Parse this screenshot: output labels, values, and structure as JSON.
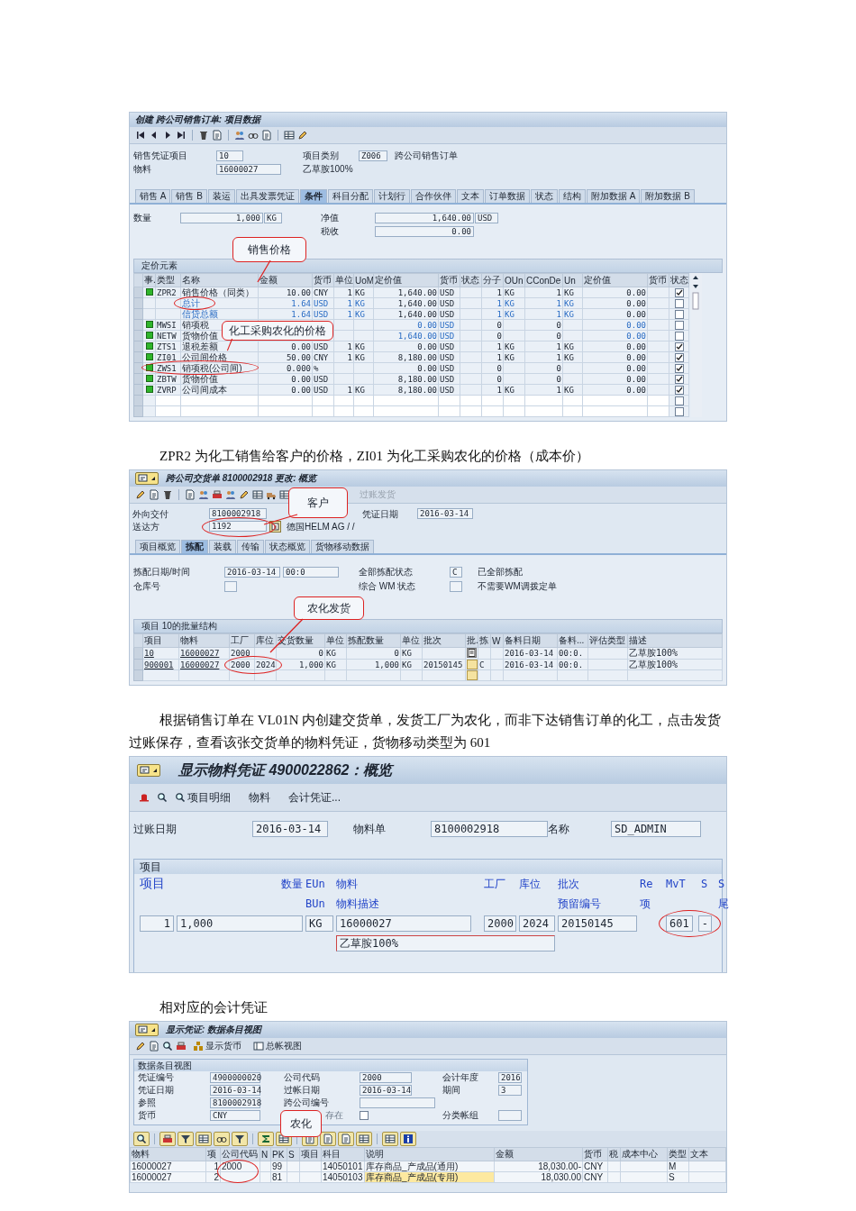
{
  "document": [
    {
      "kind": "sales_order_item",
      "title": "创建 跨公司销售订单: 项目数据",
      "header": {
        "item_label": "销售凭证项目",
        "item": "10",
        "material_label": "物料",
        "material": "16000027",
        "category_label": "项目类别",
        "category": "Z006",
        "category_text": "跨公司销售订单",
        "material_text": "乙草胺100%"
      },
      "tabs": [
        {
          "label": "销售 A",
          "selected": false
        },
        {
          "label": "销售 B",
          "selected": false
        },
        {
          "label": "装运",
          "selected": false
        },
        {
          "label": "出具发票凭证",
          "selected": false
        },
        {
          "label": "条件",
          "selected": true
        },
        {
          "label": "科目分配",
          "selected": false
        },
        {
          "label": "计划行",
          "selected": false
        },
        {
          "label": "合作伙伴",
          "selected": false
        },
        {
          "label": "文本",
          "selected": false
        },
        {
          "label": "订单数据",
          "selected": false
        },
        {
          "label": "状态",
          "selected": false
        },
        {
          "label": "结构",
          "selected": false
        },
        {
          "label": "附加数据 A",
          "selected": false
        },
        {
          "label": "附加数据 B",
          "selected": false
        }
      ],
      "quantity": {
        "label": "数量",
        "value": "1,000",
        "unit": "KG"
      },
      "net_value": {
        "label": "净值",
        "value": "1,640.00",
        "currency": "USD"
      },
      "tax": {
        "label": "税收",
        "value": "0.00"
      },
      "pricing": {
        "title": "定价元素",
        "callouts": [
          "销售价格",
          "化工采购农化的价格"
        ],
        "columns": [
          "事.",
          "类型",
          "名称",
          "金额",
          "货币",
          "单位",
          "UoM",
          "定价值",
          "货币",
          "状态",
          "分子",
          "OUn",
          "CConDe",
          "Un",
          "定价值",
          "货币",
          "状态"
        ],
        "rows": [
          {
            "kind": "condition",
            "circled": false,
            "checked": true,
            "cells": [
              "ZPR2",
              "销售价格（同类）",
              "10.00",
              "CNY",
              "1",
              "KG",
              "1,640.00",
              "USD",
              null,
              "1",
              "KG",
              "1",
              "KG",
              "0.00",
              null
            ]
          },
          {
            "kind": "subtotal",
            "circled": true,
            "checked": false,
            "cells": [
              null,
              "总计",
              "1.64",
              "USD",
              "1",
              "KG",
              "1,640.00",
              "USD",
              null,
              "1",
              "KG",
              "1",
              "KG",
              "0.00",
              null
            ]
          },
          {
            "kind": "subtotal",
            "circled": false,
            "checked": false,
            "cells": [
              null,
              "信贷总额",
              "1.64",
              "USD",
              "1",
              "KG",
              "1,640.00",
              "USD",
              null,
              "1",
              "KG",
              "1",
              "KG",
              "0.00",
              null
            ]
          },
          {
            "kind": "statistical",
            "circled": false,
            "checked": false,
            "cells": [
              "MWSI",
              "销项税",
              null,
              null,
              null,
              null,
              "0.00",
              "USD",
              null,
              "0",
              null,
              "0",
              null,
              "0.00",
              null
            ]
          },
          {
            "kind": "statistical",
            "circled": false,
            "checked": false,
            "cells": [
              "NETW",
              "货物价值",
              null,
              null,
              null,
              null,
              "1,640.00",
              "USD",
              null,
              "0",
              null,
              "0",
              null,
              "0.00",
              null
            ]
          },
          {
            "kind": "condition",
            "circled": false,
            "checked": true,
            "cells": [
              "ZTS1",
              "退税差额",
              "0.00",
              "USD",
              "1",
              "KG",
              "0.00",
              "USD",
              null,
              "1",
              "KG",
              "1",
              "KG",
              "0.00",
              null
            ]
          },
          {
            "kind": "condition",
            "circled": false,
            "checked": true,
            "cells": [
              "ZI01",
              "公司间价格",
              "50.00",
              "CNY",
              "1",
              "KG",
              "8,180.00",
              "USD",
              null,
              "1",
              "KG",
              "1",
              "KG",
              "0.00",
              null
            ]
          },
          {
            "kind": "condition",
            "circled": true,
            "checked": true,
            "cells": [
              "ZWS1",
              "销项税(公司间)",
              "0.000",
              "%",
              null,
              null,
              "0.00",
              "USD",
              null,
              "0",
              null,
              "0",
              null,
              "0.00",
              null
            ]
          },
          {
            "kind": "condition",
            "circled": false,
            "checked": true,
            "cells": [
              "ZBTW",
              "货物价值",
              "0.00",
              "USD",
              null,
              null,
              "8,180.00",
              "USD",
              null,
              "0",
              null,
              "0",
              null,
              "0.00",
              null
            ]
          },
          {
            "kind": "condition",
            "circled": false,
            "checked": true,
            "cells": [
              "ZVRP",
              "公司间成本",
              "0.00",
              "USD",
              "1",
              "KG",
              "8,180.00",
              "USD",
              null,
              "1",
              "KG",
              "1",
              "KG",
              "0.00",
              null
            ]
          },
          {
            "kind": "empty",
            "checked": false
          },
          {
            "kind": "empty",
            "checked": false
          }
        ]
      }
    },
    {
      "kind": "caption",
      "text": "ZPR2 为化工销售给客户的价格，ZI01 为化工采购农化的价格（成本价）"
    },
    {
      "kind": "delivery",
      "title": "跨公司交货单 8100002918 更改: 概览",
      "toolbar_action": {
        "label": "过账发货",
        "disabled": true
      },
      "header": [
        {
          "label": "外向交付",
          "value": "8100002918"
        },
        {
          "label": "凭证日期",
          "value": "2016-03-14"
        },
        {
          "label": "送达方",
          "value": "1192",
          "text": "德国HELM AG / /",
          "circled": true
        }
      ],
      "callouts": [
        "客户",
        "农化发货"
      ],
      "tabs": [
        {
          "label": "项目概览",
          "selected": false
        },
        {
          "label": "拣配",
          "selected": true
        },
        {
          "label": "装载",
          "selected": false
        },
        {
          "label": "传输",
          "selected": false
        },
        {
          "label": "状态概览",
          "selected": false
        },
        {
          "label": "货物移动数据",
          "selected": false
        }
      ],
      "picking": [
        {
          "label": "拣配日期/时间",
          "values": [
            "2016-03-14",
            "00:0"
          ]
        },
        {
          "label": "全部拣配状态",
          "values": [
            "C"
          ],
          "text": "已全部拣配"
        },
        {
          "label": "仓库号"
        },
        {
          "label": "综合 WM 状态",
          "text": "不需要WM调拨定单"
        }
      ],
      "batch": {
        "title": "项目 10的批量结构",
        "columns": [
          "项目",
          "物料",
          "工厂",
          "库位",
          "交货数量",
          "单位",
          "拣配数量",
          "单位",
          "批次",
          "批.",
          "拣",
          "W",
          "备料日期",
          "备料...",
          "评估类型",
          "描述"
        ],
        "rows": [
          {
            "kind": "item",
            "circled": false,
            "cells": [
              "10",
              "16000027",
              "2000",
              null,
              "0",
              "KG",
              "0",
              "KG",
              null,
              null,
              null,
              null,
              "2016-03-14",
              "00:0.",
              null,
              "乙草胺100%"
            ]
          },
          {
            "kind": "batch",
            "circled": true,
            "cells": [
              "900001",
              "16000027",
              "2000",
              "2024",
              "1,000",
              "KG",
              "1,000",
              "KG",
              "20150145",
              null,
              "C",
              null,
              "2016-03-14",
              "00:0.",
              null,
              "乙草胺100%"
            ]
          },
          {
            "kind": "empty",
            "circled": false
          }
        ]
      }
    },
    {
      "kind": "caption",
      "text": "根据销售订单在 VL01N 内创建交货单，发货工厂为农化，而非下达销售订单的化工，点击发货过账保存，查看该张交货单的物料凭证，货物移动类型为 601"
    },
    {
      "kind": "material_document",
      "title": "显示物料凭证 4900022862：概览",
      "toolbar": [
        "项目明细",
        "物料",
        "会计凭证..."
      ],
      "header": [
        {
          "label": "过账日期",
          "value": "2016-03-14"
        },
        {
          "label": "物料单",
          "value": "8100002918"
        },
        {
          "label": "名称",
          "value": "SD_ADMIN"
        }
      ],
      "items": {
        "title": "项目",
        "headers": [
          "项目",
          "数量",
          "EUn",
          "物料",
          "工厂",
          "库位",
          "批次",
          "Re",
          "MvT",
          "S",
          "S"
        ],
        "headers_2": [
          "BUn",
          "物料描述",
          "预留编号",
          "项",
          "尾"
        ],
        "row": {
          "item": "1",
          "quantity": "1,000",
          "unit": "KG",
          "material": "16000027",
          "plant": "2000",
          "storage_location": "2024",
          "batch": "20150145",
          "movement_type": "601",
          "status": "-",
          "description": "乙草胺100%",
          "circled": true
        }
      }
    },
    {
      "kind": "caption",
      "text": "相对应的会计凭证"
    },
    {
      "kind": "accounting_document",
      "title": "显示凭证: 数据条目视图",
      "toolbar": [
        "显示货币",
        "总帐视图"
      ],
      "entry": {
        "title": "数据条目视图",
        "rows": [
          [
            {
              "label": "凭证编号",
              "value": "4900000020"
            },
            {
              "label": "公司代码",
              "value": "2000"
            },
            {
              "label": "会计年度",
              "value": "2016"
            }
          ],
          [
            {
              "label": "凭证日期",
              "value": "2016-03-14"
            },
            {
              "label": "过帐日期",
              "value": "2016-03-14"
            },
            {
              "label": "期间",
              "value": "3"
            }
          ],
          [
            {
              "label": "参照",
              "value": "8100002918"
            },
            {
              "label": "跨公司编号"
            }
          ],
          [
            {
              "label": "货币",
              "value": "CNY"
            },
            {
              "kind": "checkbox",
              "label": "存在",
              "checked": false,
              "callout": "农化"
            },
            {
              "label": "分类帐组"
            }
          ]
        ]
      },
      "alv": {
        "columns": [
          "物料",
          "项",
          "公司代码",
          "N",
          "PK",
          "S",
          "项目",
          "科目",
          "说明",
          "金额",
          "货币",
          "税",
          "成本中心",
          "类型",
          "文本"
        ],
        "rows": [
          {
            "circled": true,
            "focused": false,
            "cells": [
              "16000027",
              "1",
              "2000",
              null,
              "99",
              null,
              null,
              "14050101",
              "库存商品_产成品(通用)",
              "18,030.00-",
              "CNY",
              null,
              null,
              "M",
              null
            ]
          },
          {
            "circled": false,
            "focused": true,
            "cells": [
              "16000027",
              "2",
              null,
              null,
              "81",
              null,
              null,
              "14050103",
              "库存商品_产成品(专用)",
              "18,030.00",
              "CNY",
              null,
              null,
              "S",
              null
            ]
          }
        ]
      }
    }
  ]
}
